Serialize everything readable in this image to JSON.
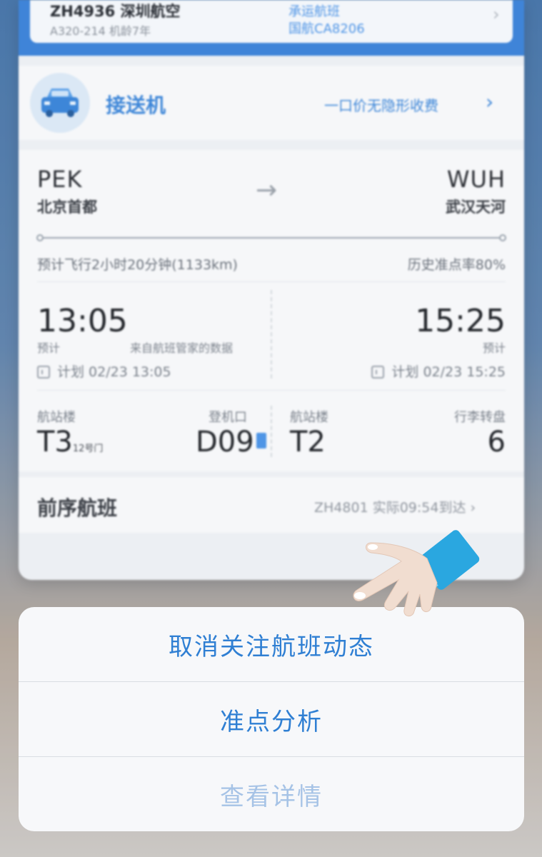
{
  "flight_header": {
    "flight": "ZH4936 深圳航空",
    "model": "A320-214 机龄7年",
    "carrier_label": "承运航班",
    "carrier": "国航CA8206"
  },
  "pickup": {
    "title": "接送机",
    "promo": "一口价无隐形收费"
  },
  "route": {
    "origin_code": "PEK",
    "origin_city": "北京首都",
    "dest_code": "WUH",
    "dest_city": "武汉天河",
    "duration": "预计飞行2小时20分钟(1133km)",
    "ontime": "历史准点率80%"
  },
  "times": {
    "dep_time": "13:05",
    "dep_note": "预计",
    "source": "来自航班管家的数据",
    "arr_time": "15:25",
    "arr_note": "预计",
    "dep_plan": "计划 02/23 13:05",
    "arr_plan": "计划 02/23 15:25"
  },
  "terminal": {
    "dep_terminal_label": "航站楼",
    "dep_terminal": "T3",
    "dep_terminal_sub": "12号门",
    "gate_label": "登机口",
    "gate": "D09",
    "arr_terminal_label": "航站楼",
    "arr_terminal": "T2",
    "baggage_label": "行李转盘",
    "baggage": "6"
  },
  "previous": {
    "title": "前序航班",
    "info": "ZH4801 实际09:54到达"
  },
  "action_sheet": {
    "unfollow": "取消关注航班动态",
    "ontime_analysis": "准点分析",
    "details": "查看详情"
  },
  "colors": {
    "accent": "#2f7fd3",
    "header_blue": "#3f84d8"
  }
}
